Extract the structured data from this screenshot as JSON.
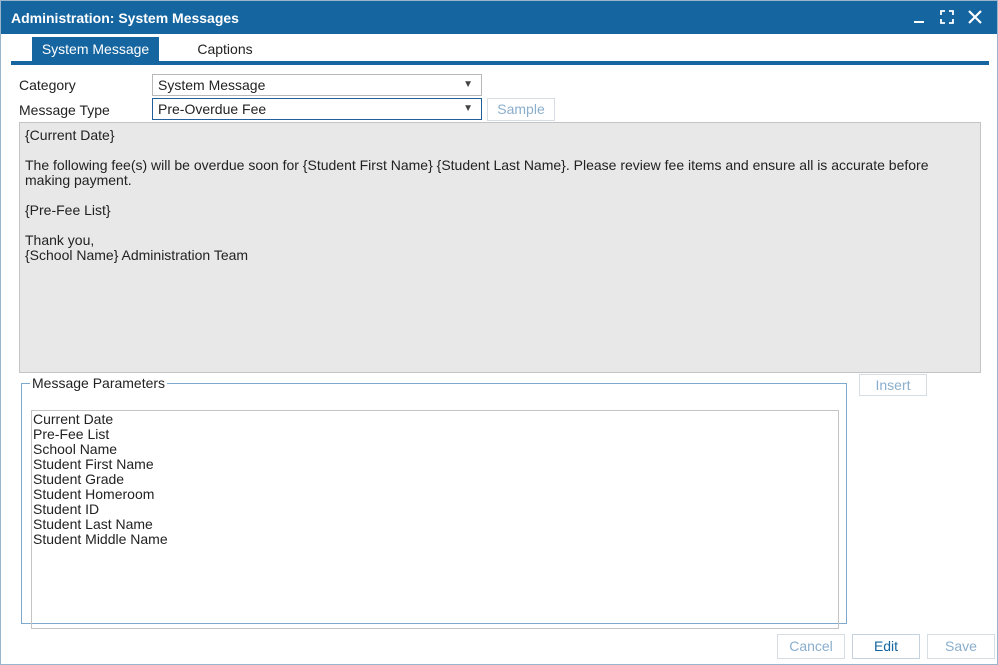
{
  "window": {
    "title": "Administration: System Messages"
  },
  "tabs": [
    {
      "label": "System Message",
      "active": true
    },
    {
      "label": "Captions",
      "active": false
    }
  ],
  "form": {
    "category_label": "Category",
    "category_value": "System Message",
    "message_type_label": "Message Type",
    "message_type_value": "Pre-Overdue Fee",
    "sample_button": "Sample"
  },
  "message_body": "{Current Date}\n\nThe following fee(s) will be overdue soon for {Student First Name} {Student Last Name}. Please review fee items and ensure all is accurate before making payment.\n\n{Pre-Fee List}\n\nThank you,\n{School Name} Administration Team",
  "parameters": {
    "legend": "Message Parameters",
    "insert_button": "Insert",
    "items": [
      "Current Date",
      "Pre-Fee List",
      "School Name",
      "Student First Name",
      "Student Grade",
      "Student Homeroom",
      "Student ID",
      "Student Last Name",
      "Student Middle Name"
    ]
  },
  "footer": {
    "cancel_button": "Cancel",
    "edit_button": "Edit",
    "save_button": "Save"
  },
  "colors": {
    "titlebar": "#1565a0",
    "body_background": "#e8e8e8",
    "fieldset_border": "#7fa9cc"
  }
}
